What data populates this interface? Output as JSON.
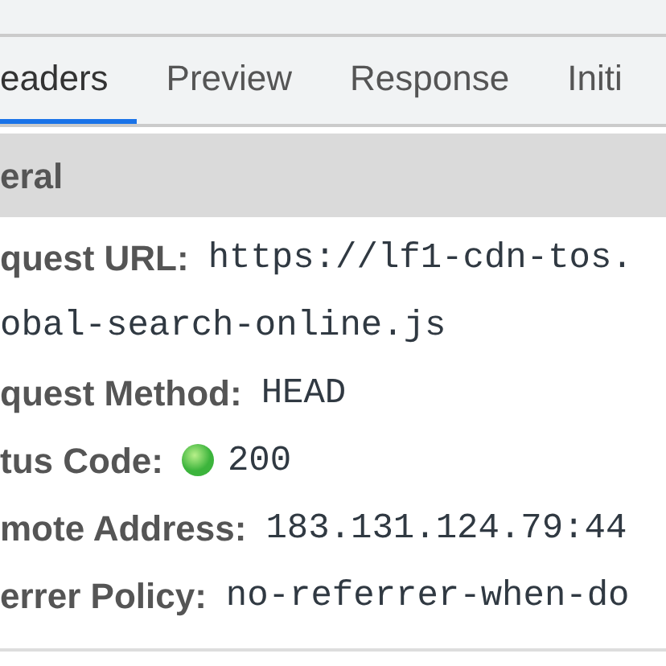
{
  "tabs": [
    {
      "label": "eaders",
      "selected": true
    },
    {
      "label": "Preview",
      "selected": false
    },
    {
      "label": "Response",
      "selected": false
    },
    {
      "label": "Initi",
      "selected": false
    }
  ],
  "general": {
    "title": "eral",
    "rows": [
      {
        "kind": "field",
        "key": "quest URL:",
        "value": "https://lf1-cdn-tos."
      },
      {
        "kind": "continuation",
        "value": "obal-search-online.js"
      },
      {
        "kind": "field",
        "key": "quest Method:",
        "value": "HEAD"
      },
      {
        "kind": "status",
        "key": "tus Code:",
        "value": "200",
        "color": "#3cb43c"
      },
      {
        "kind": "field",
        "key": "mote Address:",
        "value": "183.131.124.79:44"
      },
      {
        "kind": "field",
        "key": "errer Policy:",
        "value": "no-referrer-when-do"
      }
    ]
  }
}
